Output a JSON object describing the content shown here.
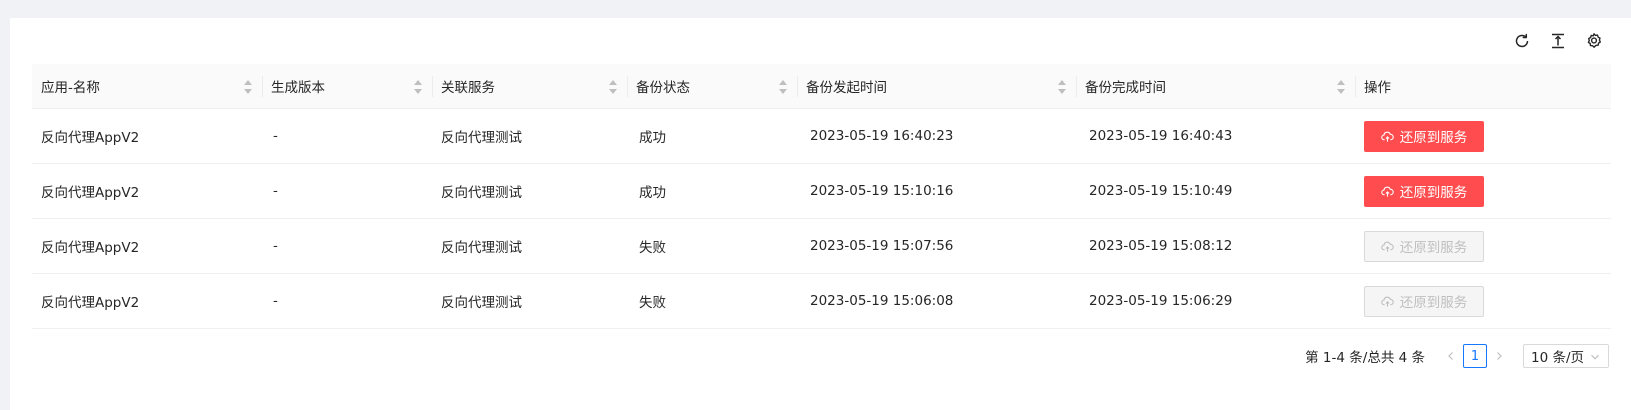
{
  "toolbar": {
    "icons": [
      "reload-icon",
      "column-height-icon",
      "setting-icon"
    ]
  },
  "table": {
    "columns": [
      {
        "label": "应用-名称",
        "sortable": true
      },
      {
        "label": "生成版本",
        "sortable": true
      },
      {
        "label": "关联服务",
        "sortable": true
      },
      {
        "label": "备份状态",
        "sortable": true
      },
      {
        "label": "备份发起时间",
        "sortable": true
      },
      {
        "label": "备份完成时间",
        "sortable": true
      },
      {
        "label": "操作",
        "sortable": false
      }
    ],
    "rows": [
      {
        "name": "反向代理AppV2",
        "version": "-",
        "service": "反向代理测试",
        "status": "成功",
        "start": "2023-05-19 16:40:23",
        "end": "2023-05-19 16:40:43",
        "action": "还原到服务",
        "enabled": true
      },
      {
        "name": "反向代理AppV2",
        "version": "-",
        "service": "反向代理测试",
        "status": "成功",
        "start": "2023-05-19 15:10:16",
        "end": "2023-05-19 15:10:49",
        "action": "还原到服务",
        "enabled": true
      },
      {
        "name": "反向代理AppV2",
        "version": "-",
        "service": "反向代理测试",
        "status": "失败",
        "start": "2023-05-19 15:07:56",
        "end": "2023-05-19 15:08:12",
        "action": "还原到服务",
        "enabled": false
      },
      {
        "name": "反向代理AppV2",
        "version": "-",
        "service": "反向代理测试",
        "status": "失败",
        "start": "2023-05-19 15:06:08",
        "end": "2023-05-19 15:06:29",
        "action": "还原到服务",
        "enabled": false
      }
    ]
  },
  "pagination": {
    "total_text": "第 1-4 条/总共 4 条",
    "current_page": "1",
    "page_size": "10 条/页"
  },
  "colors": {
    "danger": "#ff4d4f",
    "primary": "#1677ff",
    "disabled_bg": "#f5f5f5",
    "disabled_text": "#bfbfbf"
  }
}
